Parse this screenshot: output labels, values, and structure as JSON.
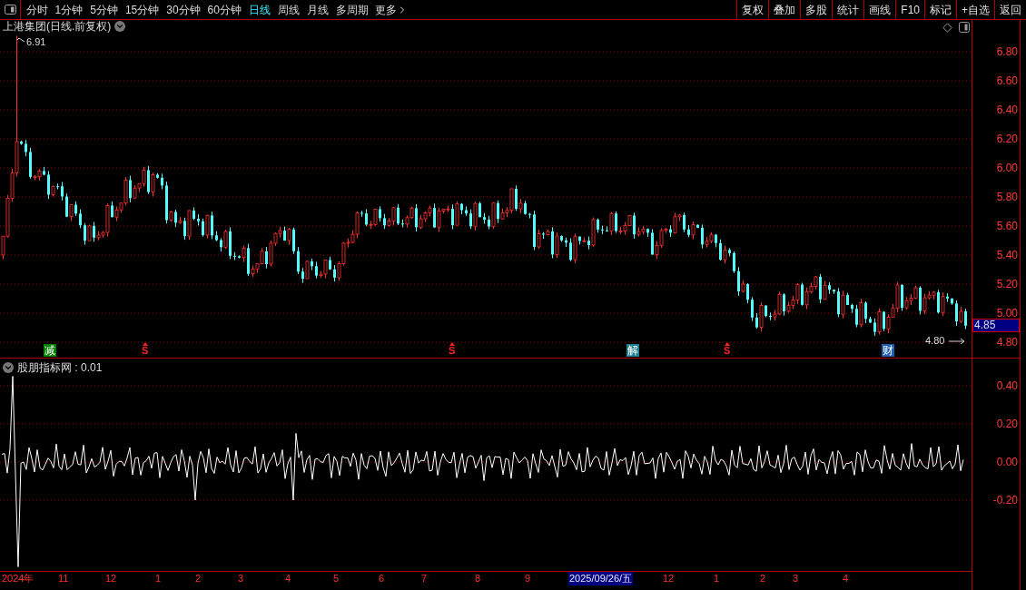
{
  "toolbar": {
    "periods": [
      {
        "label": "分时",
        "selected": false
      },
      {
        "label": "1分钟",
        "selected": false
      },
      {
        "label": "5分钟",
        "selected": false
      },
      {
        "label": "15分钟",
        "selected": false
      },
      {
        "label": "30分钟",
        "selected": false
      },
      {
        "label": "60分钟",
        "selected": false
      },
      {
        "label": "日线",
        "selected": true
      },
      {
        "label": "周线",
        "selected": false
      },
      {
        "label": "月线",
        "selected": false
      },
      {
        "label": "多周期",
        "selected": false
      }
    ],
    "more": "更多",
    "buttons": [
      "复权",
      "叠加",
      "多股",
      "统计",
      "画线",
      "F10",
      "标记",
      "+自选",
      "返回"
    ]
  },
  "chart": {
    "title": "上港集团(日线.前复权)",
    "high_label": "6.91",
    "low_label": "4.80",
    "current_price": "4.85",
    "yticks": [
      "6.80",
      "6.60",
      "6.40",
      "6.20",
      "6.00",
      "5.80",
      "5.60",
      "5.40",
      "5.20",
      "5.00",
      "4.80"
    ],
    "markers": [
      {
        "kind": "tag",
        "label": "减",
        "color": "#008000"
      },
      {
        "kind": "signal",
        "label": "S",
        "color": "#ff2020"
      },
      {
        "kind": "signal",
        "label": "S",
        "color": "#ff2020"
      },
      {
        "kind": "tag",
        "label": "解",
        "color": "#1d7f8f"
      },
      {
        "kind": "signal",
        "label": "S",
        "color": "#ff2020"
      },
      {
        "kind": "tag",
        "label": "财",
        "color": "#1f5fb0"
      }
    ]
  },
  "indicator": {
    "title": "股朋指标网 : 0.01",
    "yticks": [
      "0.40",
      "0.20",
      "0.00",
      "-0.20"
    ]
  },
  "time_axis": {
    "labels": [
      {
        "text": "2024年",
        "selected": false
      },
      {
        "text": "11",
        "selected": false
      },
      {
        "text": "12",
        "selected": false
      },
      {
        "text": "1",
        "selected": false
      },
      {
        "text": "2",
        "selected": false
      },
      {
        "text": "3",
        "selected": false
      },
      {
        "text": "4",
        "selected": false
      },
      {
        "text": "5",
        "selected": false
      },
      {
        "text": "6",
        "selected": false
      },
      {
        "text": "7",
        "selected": false
      },
      {
        "text": "8",
        "selected": false
      },
      {
        "text": "9",
        "selected": false
      },
      {
        "text": "2025/09/26/五",
        "selected": true
      },
      {
        "text": "12",
        "selected": false
      },
      {
        "text": "1",
        "selected": false
      },
      {
        "text": "2",
        "selected": false
      },
      {
        "text": "3",
        "selected": false
      },
      {
        "text": "4",
        "selected": false
      }
    ]
  }
}
